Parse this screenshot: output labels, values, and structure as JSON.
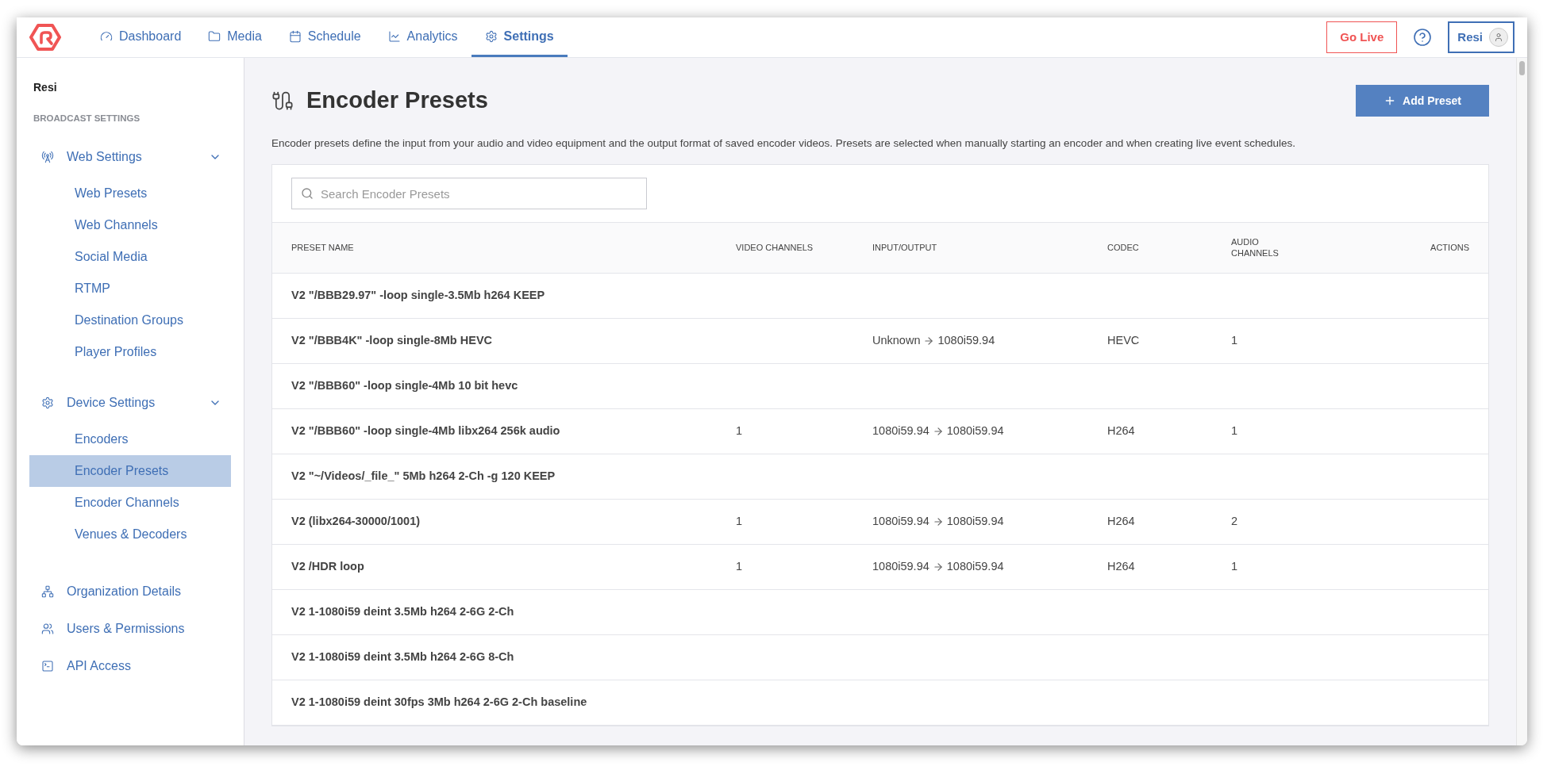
{
  "nav": {
    "tabs": [
      {
        "label": "Dashboard",
        "selected": false
      },
      {
        "label": "Media",
        "selected": false
      },
      {
        "label": "Schedule",
        "selected": false
      },
      {
        "label": "Analytics",
        "selected": false
      },
      {
        "label": "Settings",
        "selected": true
      }
    ],
    "go_live": "Go Live",
    "user": "Resi"
  },
  "sidebar": {
    "org": "Resi",
    "section": "BROADCAST SETTINGS",
    "groups": [
      {
        "label": "Web Settings",
        "expanded": true,
        "children": [
          {
            "label": "Web Presets",
            "selected": false
          },
          {
            "label": "Web Channels",
            "selected": false
          },
          {
            "label": "Social Media",
            "selected": false
          },
          {
            "label": "RTMP",
            "selected": false
          },
          {
            "label": "Destination Groups",
            "selected": false
          },
          {
            "label": "Player Profiles",
            "selected": false
          }
        ]
      },
      {
        "label": "Device Settings",
        "expanded": true,
        "children": [
          {
            "label": "Encoders",
            "selected": false
          },
          {
            "label": "Encoder Presets",
            "selected": true
          },
          {
            "label": "Encoder Channels",
            "selected": false
          },
          {
            "label": "Venues & Decoders",
            "selected": false
          }
        ]
      }
    ],
    "links": [
      {
        "label": "Organization Details"
      },
      {
        "label": "Users & Permissions"
      },
      {
        "label": "API Access"
      }
    ]
  },
  "page": {
    "title": "Encoder Presets",
    "add_button": "Add Preset",
    "description": "Encoder presets define the input from your audio and video equipment and the output format of saved encoder videos. Presets are selected when manually starting an encoder and when creating live event schedules.",
    "search": {
      "placeholder": "Search Encoder Presets"
    }
  },
  "table": {
    "columns": [
      "PRESET NAME",
      "VIDEO CHANNELS",
      "INPUT/OUTPUT",
      "CODEC",
      "AUDIO CHANNELS",
      "ACTIONS"
    ],
    "rows": [
      {
        "name": "V2 \"/BBB29.97\" -loop single-3.5Mb h264 KEEP"
      },
      {
        "name": "V2 \"/BBB4K\" -loop single-8Mb HEVC",
        "input": "Unknown",
        "output": "1080i59.94",
        "codec": "HEVC",
        "audio_channels": "1"
      },
      {
        "name": "V2 \"/BBB60\" -loop single-4Mb 10 bit hevc"
      },
      {
        "name": "V2 \"/BBB60\" -loop single-4Mb libx264 256k audio",
        "video_channels": "1",
        "input": "1080i59.94",
        "output": "1080i59.94",
        "codec": "H264",
        "audio_channels": "1"
      },
      {
        "name": "V2 \"~/Videos/_file_\" 5Mb h264 2-Ch -g 120 KEEP"
      },
      {
        "name": "V2 (libx264-30000/1001)",
        "video_channels": "1",
        "input": "1080i59.94",
        "output": "1080i59.94",
        "codec": "H264",
        "audio_channels": "2"
      },
      {
        "name": "V2 /HDR loop",
        "video_channels": "1",
        "input": "1080i59.94",
        "output": "1080i59.94",
        "codec": "H264",
        "audio_channels": "1"
      },
      {
        "name": "V2 1-1080i59 deint 3.5Mb h264 2-6G 2-Ch"
      },
      {
        "name": "V2 1-1080i59 deint 3.5Mb h264 2-6G 8-Ch"
      },
      {
        "name": "V2 1-1080i59 deint 30fps 3Mb h264 2-6G 2-Ch baseline"
      }
    ]
  }
}
